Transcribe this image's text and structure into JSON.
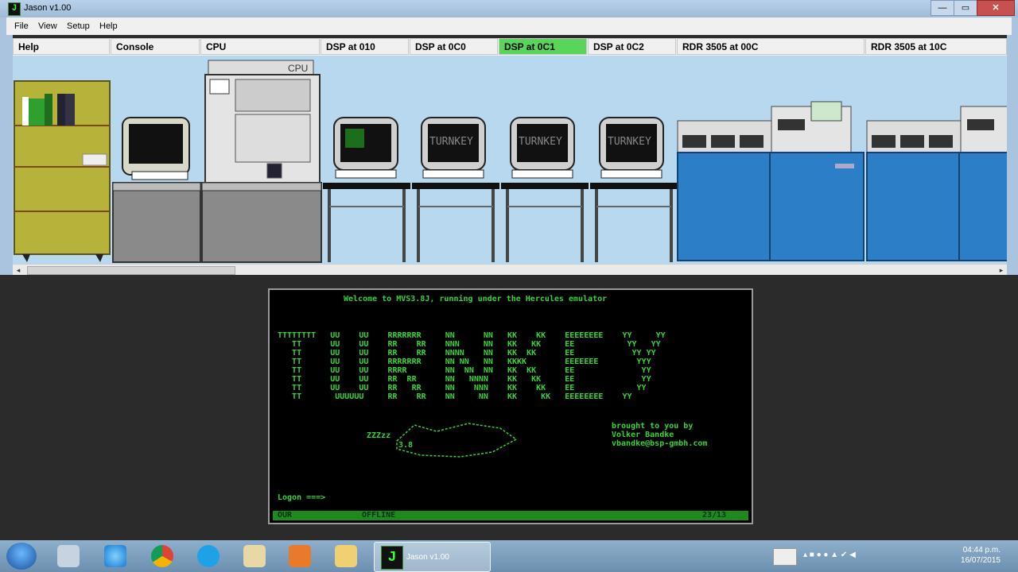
{
  "window": {
    "title": "Jason v1.00",
    "icon_glyph": "J"
  },
  "menu": {
    "items": [
      "File",
      "View",
      "Setup",
      "Help"
    ]
  },
  "tabs": [
    {
      "label": "Help",
      "active": false
    },
    {
      "label": "Console",
      "active": false
    },
    {
      "label": "CPU",
      "active": false
    },
    {
      "label": "DSP at 010",
      "active": false
    },
    {
      "label": "DSP at 0C0",
      "active": false
    },
    {
      "label": "DSP at 0C1",
      "active": true
    },
    {
      "label": "DSP at 0C2",
      "active": false
    },
    {
      "label": "RDR 3505 at 00C",
      "active": false
    },
    {
      "label": "RDR 3505 at 10C",
      "active": false
    }
  ],
  "machine_room": {
    "cpu_label": "CPU",
    "monitor_text": "TURNKEY"
  },
  "terminal": {
    "welcome": "Welcome to MVS3.8J, running under the Hercules emulator",
    "banner": [
      "TTTTTTTT   UU    UU    RRRRRRR     NN      NN   KK    KK    EEEEEEEE    YY     YY",
      "   TT      UU    UU    RR    RR    NNN     NN   KK   KK     EE           YY   YY",
      "   TT      UU    UU    RR    RR    NNNN    NN   KK  KK      EE            YY YY",
      "   TT      UU    UU    RRRRRRR     NN NN   NN   KKKK        EEEEEEE        YYY",
      "   TT      UU    UU    RRRR        NN  NN  NN   KK  KK      EE              YY",
      "   TT      UU    UU    RR  RR      NN   NNNN    KK   KK     EE              YY",
      "   TT      UU    UU    RR   RR     NN    NNN    KK    KK    EE             YY",
      "   TT       UUUUUU     RR    RR    NN     NN    KK     KK   EEEEEEEE    YY"
    ],
    "credit": [
      "brought to you by",
      "Volker Bandke",
      "vbandke@bsp-gmbh.com"
    ],
    "art_label": "ZZZzz",
    "art_version": "3.8",
    "prompt": "Logon ===>",
    "status_left": "OUR",
    "status_mid": "OFFLINE",
    "status_right": "23/13"
  },
  "taskbar": {
    "running_app": "Jason v1.00",
    "time": "04:44 p.m.",
    "date": "16/07/2015"
  }
}
